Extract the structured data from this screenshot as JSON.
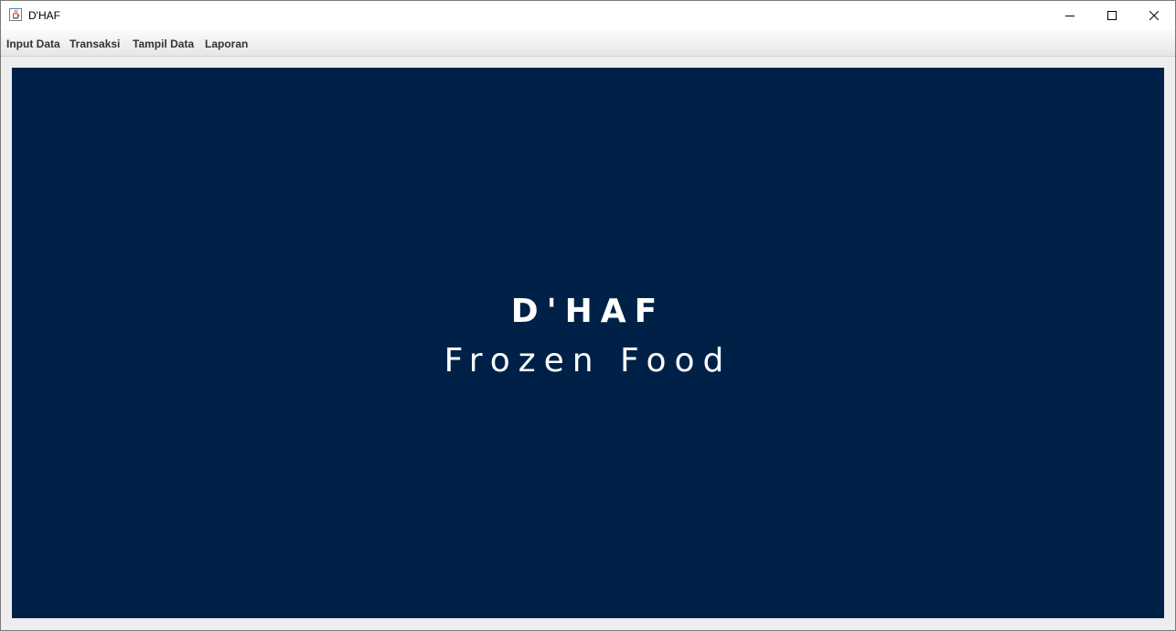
{
  "window": {
    "title": "D'HAF",
    "app_icon": "java-coffee-cup-icon"
  },
  "window_controls": {
    "minimize_icon": "minimize-icon",
    "maximize_icon": "maximize-icon",
    "close_icon": "close-icon"
  },
  "menubar": {
    "items": [
      {
        "label": "Input Data"
      },
      {
        "label": "Transaksi"
      },
      {
        "label": "Tampil Data"
      },
      {
        "label": "Laporan"
      }
    ]
  },
  "main": {
    "brand": "D'HAF",
    "tagline": "Frozen Food",
    "background_color": "#002147",
    "text_color": "#ffffff"
  }
}
